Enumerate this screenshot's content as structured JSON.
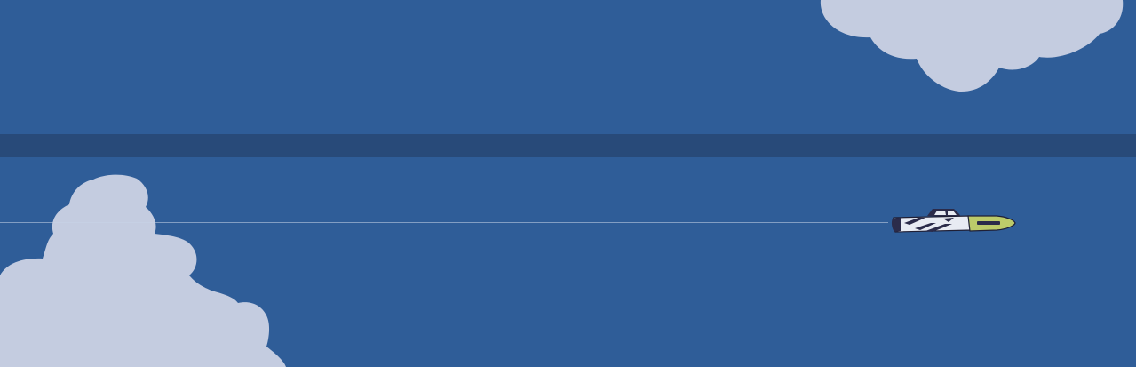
{
  "scene": {
    "colors": {
      "sky": "#2f5d98",
      "band": "#284a79",
      "cloud": "#c4cce0",
      "trail": "#c9d4e8",
      "ship_body": "#e8ebf3",
      "ship_dark": "#2b2b4a",
      "ship_nose": "#bccb6a",
      "ship_outline": "#1f1f35"
    },
    "objects": [
      "cloud-top-right",
      "cloud-bottom-left",
      "horizon-band",
      "speed-trail",
      "spaceship-icon"
    ]
  }
}
